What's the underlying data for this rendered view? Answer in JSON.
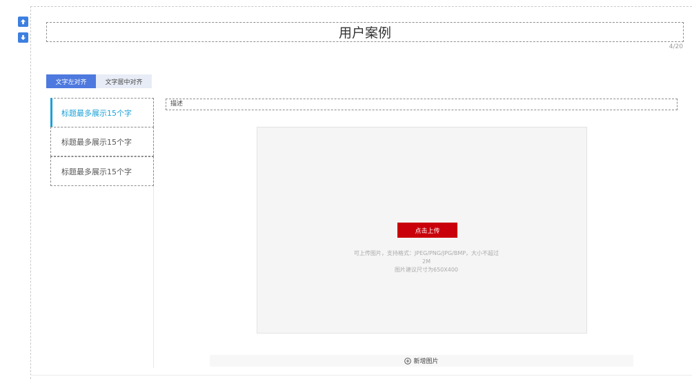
{
  "toolbar": {
    "move_up_icon": "arrow-up-icon",
    "move_down_icon": "arrow-down-icon",
    "accent_color": "#3d7fe0"
  },
  "title": {
    "text": "用户案例",
    "char_count": "4/20"
  },
  "align_tabs": [
    {
      "label": "文字左对齐",
      "active": true
    },
    {
      "label": "文字居中对齐",
      "active": false
    }
  ],
  "side_items": [
    {
      "label": "标题最多展示15个字",
      "active": true
    },
    {
      "label": "标题最多展示15个字",
      "active": false
    },
    {
      "label": "标题最多展示15个字",
      "active": false
    }
  ],
  "description": {
    "placeholder": "描述"
  },
  "upload": {
    "button_label": "点击上传",
    "hint_line1": "可上传图片，支持格式：JPEG/PNG/JPG/BMP，大小不超过2M",
    "hint_line2": "图片建议尺寸为650X400",
    "button_color": "#c9000b"
  },
  "add_image": {
    "label": "新增图片",
    "icon": "plus-circle-icon"
  },
  "colors": {
    "active_item": "#1aa0d8",
    "active_tab": "#4e79de",
    "inactive_tab": "#e7ecf6"
  }
}
